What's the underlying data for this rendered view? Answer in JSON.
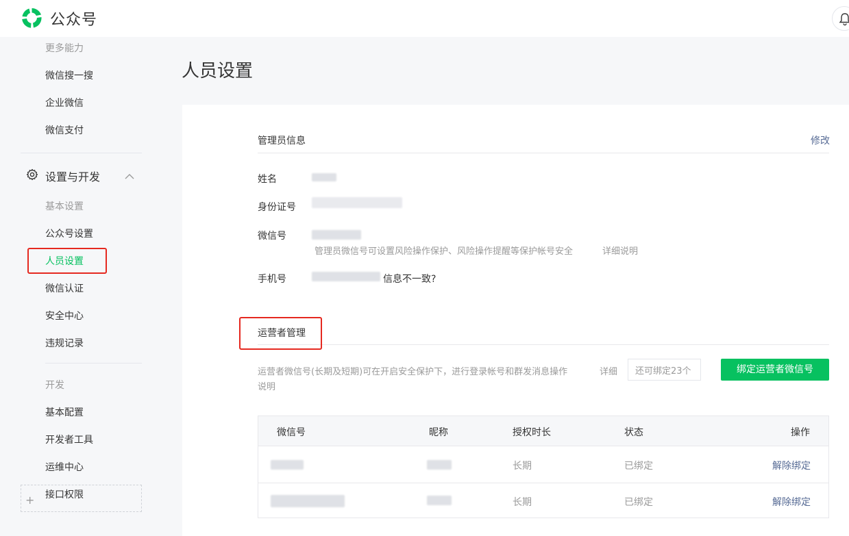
{
  "header": {
    "brand": "公众号",
    "logo_icon": "wechat-official-account-logo",
    "bell_icon": "bell-icon",
    "brand_color": "#07c160"
  },
  "sidebar": {
    "top_category": "更多能力",
    "top_items": [
      "微信搜一搜",
      "企业微信",
      "微信支付"
    ],
    "group_label": "设置与开发",
    "settings_category": "基本设置",
    "settings_items": [
      "公众号设置",
      "人员设置",
      "微信认证",
      "安全中心",
      "违规记录"
    ],
    "active_item": "人员设置",
    "dev_category": "开发",
    "dev_items": [
      "基本配置",
      "开发者工具",
      "运维中心",
      "接口权限"
    ]
  },
  "main": {
    "title": "人员设置",
    "admin": {
      "section_title": "管理员信息",
      "edit_link": "修改",
      "name_label": "姓名",
      "id_label": "身份证号",
      "wechat_label": "微信号",
      "wechat_hint": "管理员微信号可设置风险操作保护、风险操作提醒等保护帐号安全",
      "wechat_hint_link": "详细说明",
      "phone_label": "手机号",
      "phone_link": "信息不一致?"
    },
    "operators": {
      "section_title": "运营者管理",
      "desc": "运营者微信号(长期及短期)可在开启安全保护下，进行登录帐号和群发消息操作",
      "desc_link_1": "详细",
      "desc_link_2": "说明",
      "quota": "还可绑定23个",
      "bind_button": "绑定运营者微信号",
      "columns": [
        "微信号",
        "昵称",
        "授权时长",
        "状态",
        "操作"
      ],
      "rows": [
        {
          "duration": "长期",
          "status": "已绑定",
          "action": "解除绑定"
        },
        {
          "duration": "长期",
          "status": "已绑定",
          "action": "解除绑定"
        }
      ]
    }
  }
}
